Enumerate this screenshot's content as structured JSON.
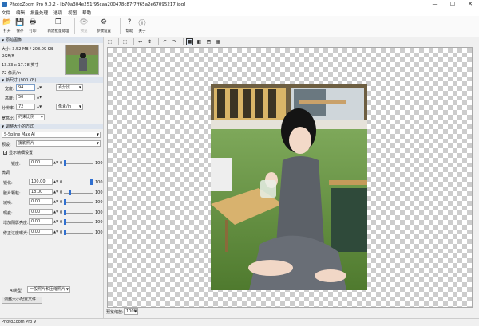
{
  "window": {
    "title": "PhotoZoom Pro 9.0.2 - [b70a304e251f95caa200478c87f7ff65a2e67095217.jpg]",
    "minimize": "—",
    "maximize": "☐",
    "close": "✕"
  },
  "menu": [
    "文件",
    "编辑",
    "批量处理",
    "选项",
    "视图",
    "帮助"
  ],
  "toolbar": [
    {
      "label": "打开",
      "icon": "open-icon",
      "glyph": "📂"
    },
    {
      "label": "保存",
      "icon": "save-icon",
      "glyph": "💾"
    },
    {
      "label": "打印",
      "icon": "print-icon",
      "glyph": "🖶"
    },
    {
      "label": "新建批量处理",
      "icon": "batch-icon",
      "glyph": "❐"
    },
    {
      "label": "预览",
      "icon": "preview-icon",
      "glyph": "👁"
    },
    {
      "label": "参数设置",
      "icon": "settings-icon",
      "glyph": "⚙"
    },
    {
      "label": "帮助",
      "icon": "help-icon",
      "glyph": "?"
    },
    {
      "label": "关于",
      "icon": "about-icon",
      "glyph": "ⓘ"
    }
  ],
  "source": {
    "header": "原始图像",
    "size": "大小: 3.52 MB / 208.09 KB",
    "color": "RGB/8",
    "dims": "13.33 x 17.78 英寸",
    "dpi": "72 像素/in"
  },
  "new_size": {
    "header": "新尺寸 (900 KB)",
    "width_label": "宽度:",
    "width_value": "94",
    "height_label": "高度:",
    "height_value": "50",
    "res_label": "分辨率:",
    "res_value": "72",
    "unit_pct": "百分比",
    "unit_px": "像素/in",
    "ratio_label": "宽高比:",
    "ratio_value": "约束比例"
  },
  "method": {
    "header": "调整大小的方式",
    "algorithm": "S-Spline Max AI",
    "preset_label": "预设:",
    "preset_value": "摄影照片",
    "show_settings": "显示精细设置",
    "sharpness_label": "锐度:",
    "sharpness_value": "0.00"
  },
  "fine": {
    "header": "微调",
    "rows": [
      {
        "label": "锐化:",
        "value": "100.00",
        "fill": 1.0
      },
      {
        "label": "胶片颗粒:",
        "value": "18.00",
        "fill": 0.18
      },
      {
        "label": "减噪:",
        "value": "0.00",
        "fill": 0.0
      },
      {
        "label": "瑕疵:",
        "value": "0.00",
        "fill": 0.0
      },
      {
        "label": "增加阴影亮度:",
        "value": "0.00",
        "fill": 0.0
      },
      {
        "label": "修正过度曝光:",
        "value": "0.00",
        "fill": 0.0
      }
    ],
    "range_min": "0",
    "range_max": "100",
    "ai_label": "AI类型:",
    "ai_value": "一般照片和压缩照片",
    "config_button": "调整大小配置文件..."
  },
  "zoom": {
    "label": "预览缩放:",
    "value": "100%"
  },
  "status": "PhotoZoom Pro 9"
}
